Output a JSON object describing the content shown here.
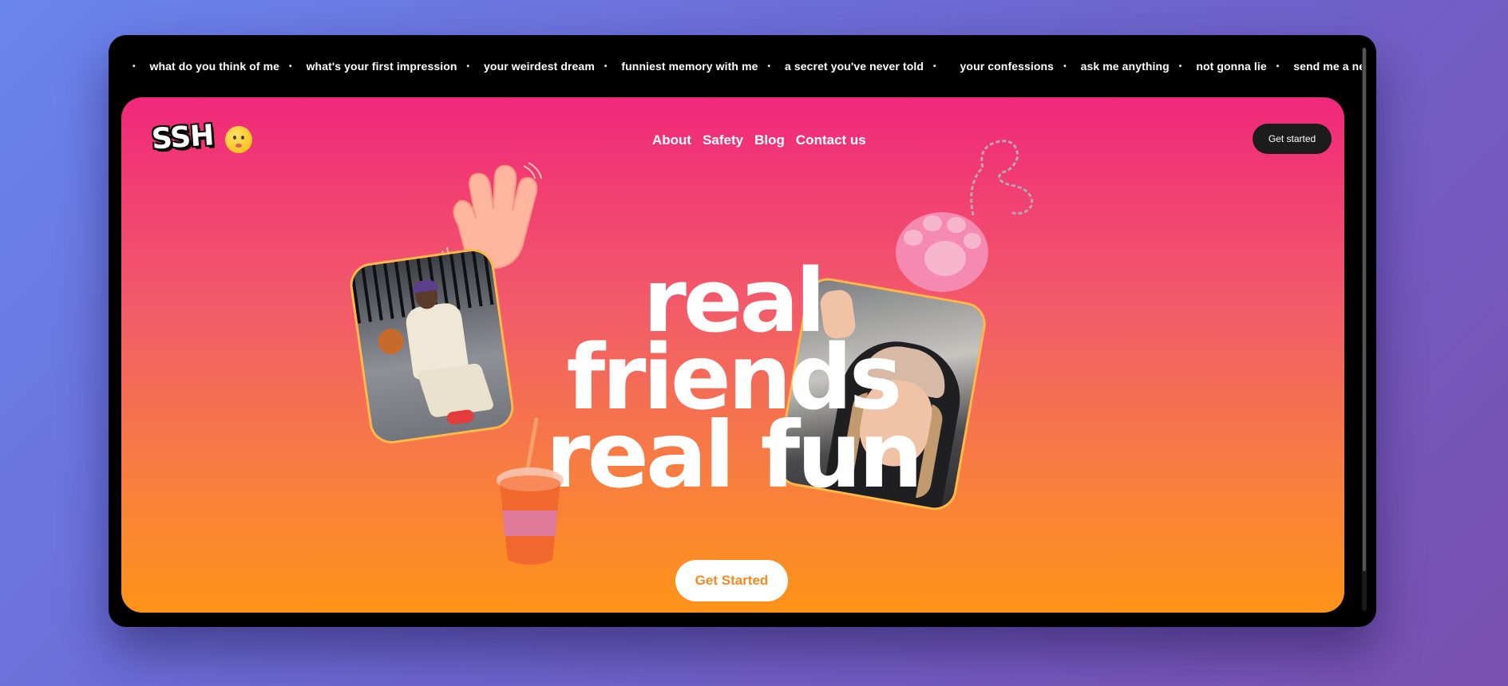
{
  "ticker": {
    "items": [
      "what do you think of me",
      "what's your first impression",
      "your weirdest dream",
      "funniest memory with me",
      "a secret you've never told",
      "your confessions",
      "ask me anything",
      "not gonna lie",
      "send me a never have I ever"
    ],
    "separator": "•"
  },
  "brand": {
    "logo_text": "SSH",
    "emoji_icon": "shushing-face-icon"
  },
  "nav": {
    "items": [
      "About",
      "Safety",
      "Blog",
      "Contact us"
    ]
  },
  "header_cta": {
    "label": "Get started"
  },
  "hero": {
    "line1": "real",
    "line2": "friends",
    "line3": "real fun",
    "cta_label": "Get Started"
  },
  "colors": {
    "hero_top": "#f0287a",
    "hero_bottom": "#fd9418",
    "cta_text": "#f7891e",
    "dark_button": "#1c1c1c"
  }
}
